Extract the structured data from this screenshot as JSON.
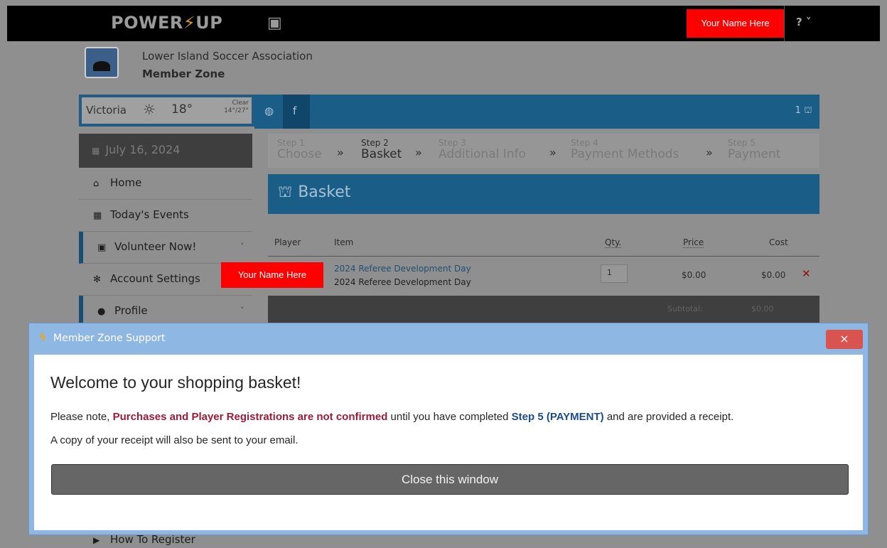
{
  "app": {
    "logo_text_a": "POWER",
    "logo_bolt": "⚡",
    "logo_text_b": "UP",
    "user_badge": "Your Name Here",
    "help_icon": "?"
  },
  "org": {
    "name": "Lower Island Soccer Association",
    "subtitle": "Member Zone"
  },
  "weather": {
    "city": "Victoria",
    "temp": "18°",
    "condition": "Clear",
    "range": "14°/27°"
  },
  "cart": {
    "count": "1"
  },
  "sidebar": {
    "date": "July 16, 2024",
    "items": [
      {
        "label": "Home",
        "icon": "home-icon"
      },
      {
        "label": "Today's Events",
        "icon": "calendar-icon"
      },
      {
        "label": "Volunteer Now!",
        "icon": "volunteer-icon"
      },
      {
        "label": "Account Settings",
        "icon": "gear-icon"
      },
      {
        "label": "Profile",
        "icon": "user-icon"
      },
      {
        "label": "How To Register",
        "icon": "video-icon"
      }
    ]
  },
  "steps": [
    {
      "num": "Step 1",
      "label": "Choose"
    },
    {
      "num": "Step 2",
      "label": "Basket"
    },
    {
      "num": "Step 3",
      "label": "Additional Info"
    },
    {
      "num": "Step 4",
      "label": "Payment Methods"
    },
    {
      "num": "Step 5",
      "label": "Payment"
    }
  ],
  "basket": {
    "title": "Basket",
    "columns": {
      "player": "Player",
      "item": "Item",
      "qty": "Qty.",
      "price": "Price",
      "cost": "Cost"
    },
    "row": {
      "player_overlay": "Your Name Here",
      "item_link": "2024 Referee Development Day",
      "item_sub": "2024 Referee Development Day",
      "qty": "1",
      "price": "$0.00",
      "cost": "$0.00"
    },
    "subtotal_label": "Subtotal:",
    "subtotal_value": "$0.00"
  },
  "modal": {
    "title": "Member Zone Support",
    "close": "×",
    "heading": "Welcome to your shopping basket!",
    "p1_a": "Please note, ",
    "p1_warn": "Purchases and Player Registrations are not confirmed",
    "p1_b": " until you have completed ",
    "p1_step": "Step 5 (PAYMENT)",
    "p1_c": " and are provided a receipt.",
    "p2": "A copy of your receipt will also be sent to your email.",
    "button": "Close this window"
  }
}
